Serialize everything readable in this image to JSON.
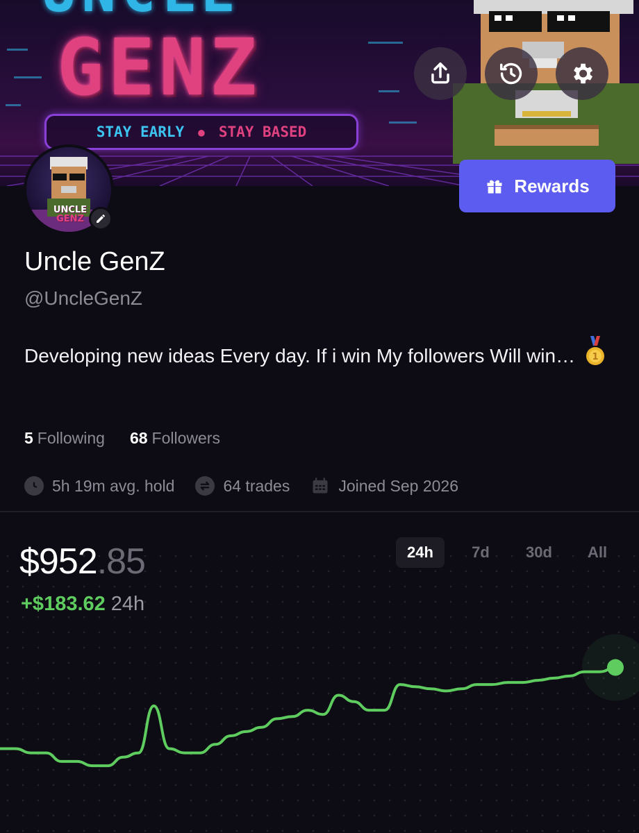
{
  "banner": {
    "title_top": "UNCLE",
    "title": "GENZ",
    "tagline_left": "STAY EARLY",
    "tagline_right": "STAY BASED"
  },
  "header_actions": {
    "share": "share-icon",
    "history": "history-icon",
    "settings": "gear-icon"
  },
  "avatar": {
    "label_top": "UNCLE",
    "label_bottom": "GENZ"
  },
  "rewards": {
    "label": "Rewards",
    "icon": "gift-icon"
  },
  "profile": {
    "name": "Uncle GenZ",
    "handle": "@UncleGenZ",
    "bio": "Developing new ideas Every day. If i win My followers Will win…",
    "following_count": "5",
    "following_label": "Following",
    "followers_count": "68",
    "followers_label": "Followers",
    "avg_hold": "5h 19m avg. hold",
    "trades": "64 trades",
    "joined": "Joined Sep 2026"
  },
  "portfolio": {
    "balance_whole": "$952",
    "balance_cents": ".85",
    "change_value": "+$183.62",
    "change_period": "24h",
    "ranges": [
      "24h",
      "7d",
      "30d",
      "All"
    ],
    "active_range": "24h"
  },
  "colors": {
    "accent": "#5c5cf0",
    "positive": "#5fcc5f",
    "background": "#0d0c14"
  },
  "chart_data": {
    "type": "line",
    "series": [
      {
        "values": [
          770,
          770,
          768,
          768,
          764,
          764,
          762,
          762,
          766,
          768,
          790,
          770,
          768,
          768,
          772,
          776,
          778,
          780,
          784,
          785,
          788,
          786,
          795,
          792,
          788,
          788,
          800,
          799,
          798,
          797,
          798,
          800,
          800,
          801,
          801,
          802,
          803,
          804,
          806,
          806,
          808
        ]
      }
    ],
    "ylim": [
      750,
      815
    ]
  }
}
